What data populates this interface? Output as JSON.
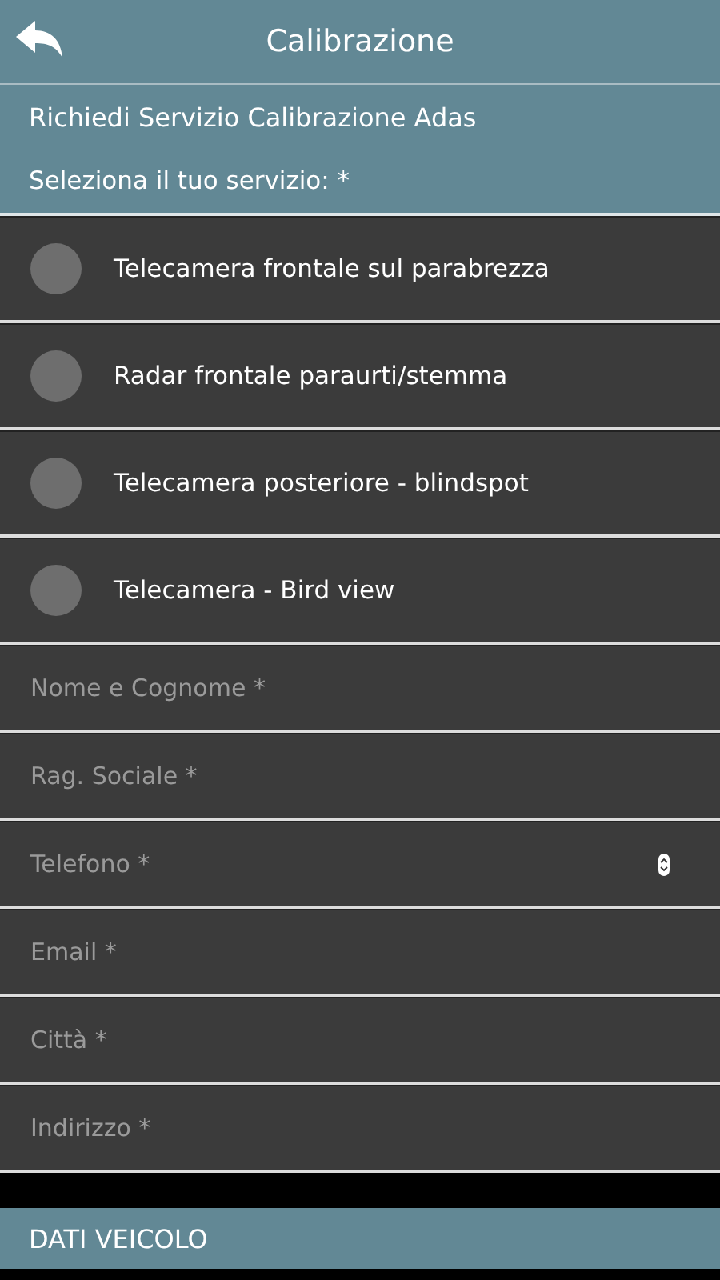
{
  "header": {
    "title": "Calibrazione"
  },
  "intro": {
    "title": "Richiedi Servizio Calibrazione Adas",
    "prompt": "Seleziona il tuo servizio: *"
  },
  "services": [
    {
      "label": "Telecamera frontale sul parabrezza",
      "selected": false
    },
    {
      "label": "Radar frontale paraurti/stemma",
      "selected": false
    },
    {
      "label": "Telecamera posteriore - blindspot",
      "selected": false
    },
    {
      "label": "Telecamera - Bird view",
      "selected": false
    }
  ],
  "fields": [
    {
      "placeholder": "Nome e Cognome *",
      "kind": "text"
    },
    {
      "placeholder": "Rag. Sociale *",
      "kind": "text"
    },
    {
      "placeholder": "Telefono *",
      "kind": "number"
    },
    {
      "placeholder": "Email *",
      "kind": "text"
    },
    {
      "placeholder": "Città *",
      "kind": "text"
    },
    {
      "placeholder": "Indirizzo *",
      "kind": "text"
    }
  ],
  "section": {
    "title": "DATI VEICOLO"
  }
}
